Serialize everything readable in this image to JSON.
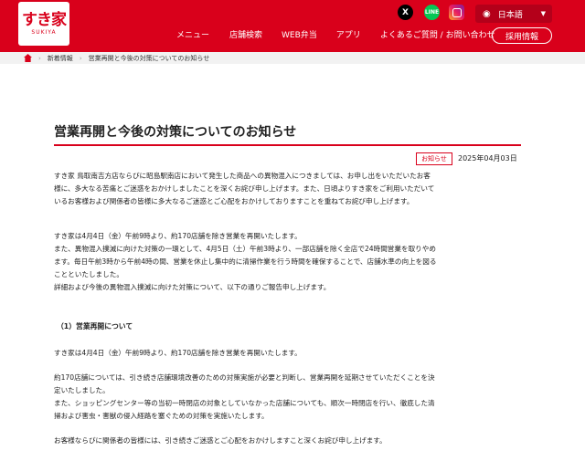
{
  "header": {
    "logo_text": "すき家",
    "logo_sub": "SUKIYA",
    "social": {
      "x": "X",
      "line": "LINE"
    },
    "language": "日本語",
    "nav": [
      "メニュー",
      "店舗検索",
      "WEB弁当",
      "アプリ",
      "よくあるご質問 / お問い合わせ"
    ],
    "recruit_label": "採用情報"
  },
  "breadcrumb": [
    "新着情報",
    "営業再開と今後の対策についてのお知らせ"
  ],
  "article": {
    "title": "営業再開と今後の対策についてのお知らせ",
    "tag": "お知らせ",
    "date": "2025年04月03日",
    "intro": [
      "すき家 鳥取南吉方店ならびに昭島駅南店において発生した商品への異物混入につきましては、お申し出をいただいたお客",
      "様に、多大なる苦痛とご迷惑をおかけしましたことを深くお詫び申し上げます。また、日頃よりすき家をご利用いただいて",
      "いるお客様および関係者の皆様に多大なるご迷惑とご心配をおかけしておりますことを重ねてお詫び申し上げます。"
    ],
    "summary": [
      "すき家は4月4日（金）午前9時より、約170店舗を除き営業を再開いたします。",
      "また、異物混入撲滅に向けた対策の一環として、4月5日（土）午前3時より、一部店舗を除く全店で24時間営業を取りやめ",
      "ます。毎日午前3時から午前4時の間、営業を休止し集中的に清掃作業を行う時間を確保することで、店舗水準の向上を図る",
      "ことといたしました。",
      "詳細および今後の異物混入撲滅に向けた対策について、以下の通りご報告申し上げます。"
    ],
    "section1_heading": "（1）営業再開について",
    "section1_lead": "すき家は4月4日（金）午前9時より、約170店舗を除き営業を再開いたします。",
    "section1_detail": [
      "約170店舗については、引き続き店舗環境改善のための対策実施が必要と判断し、営業再開を延期させていただくことを決",
      "定いたしました。",
      "また、ショッピングセンター等の当初一時閉店の対象としていなかった店舗についても、順次一時閉店を行い、徹底した清",
      "掃および害虫・害獣の侵入経路を塞ぐための対策を実施いたします。"
    ],
    "closing": "お客様ならびに関係者の皆様には、引き続きご迷惑とご心配をおかけしますこと深くお詫び申し上げます。"
  },
  "colors": {
    "brand_red": "#d9001b",
    "breadcrumb_bg": "#f2f2f2"
  }
}
